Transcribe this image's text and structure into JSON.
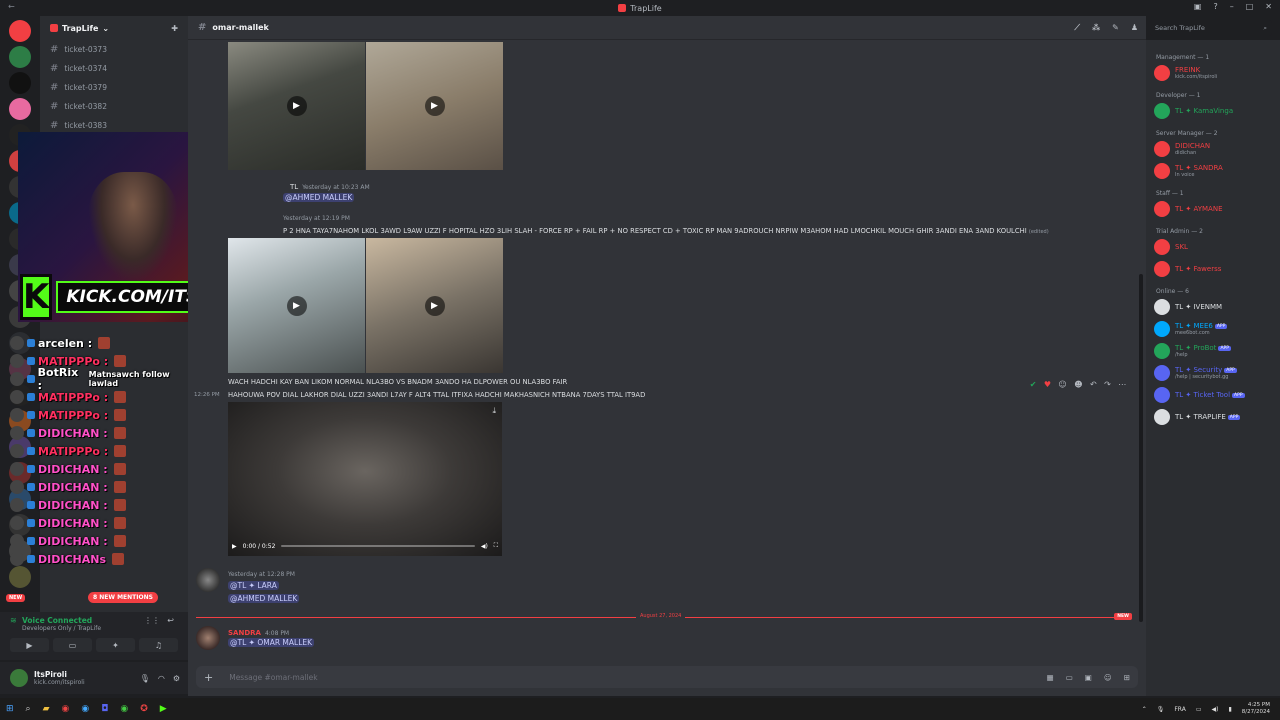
{
  "window": {
    "title": "TrapLife"
  },
  "server": {
    "name": "TrapLife"
  },
  "channels": [
    "ticket-0373",
    "ticket-0374",
    "ticket-0379",
    "ticket-0382",
    "ticket-0383"
  ],
  "active_channel": "omar-mallek",
  "stream_overlay": {
    "kick_url": "KICK.COM/ITSPIROLI",
    "chat": [
      {
        "name": "arcelen :",
        "color": "#ffffff",
        "text": ""
      },
      {
        "name": "MATIPPPo :",
        "color": "#ff3060",
        "text": ""
      },
      {
        "name": "BotRix :",
        "color": "#ffffff",
        "text": "Matnsawch follow lawlad"
      },
      {
        "name": "MATIPPPo :",
        "color": "#ff3060",
        "text": ""
      },
      {
        "name": "MATIPPPo :",
        "color": "#ff3060",
        "text": ""
      },
      {
        "name": "DIDICHAN :",
        "color": "#ff50c8",
        "text": ""
      },
      {
        "name": "MATIPPPo :",
        "color": "#ff3060",
        "text": ""
      },
      {
        "name": "DIDICHAN :",
        "color": "#ff50c8",
        "text": ""
      },
      {
        "name": "DIDICHAN :",
        "color": "#ff50c8",
        "text": ""
      },
      {
        "name": "DIDICHAN :",
        "color": "#ff50c8",
        "text": ""
      },
      {
        "name": "DIDICHAN :",
        "color": "#ff50c8",
        "text": ""
      },
      {
        "name": "DIDICHAN :",
        "color": "#ff50c8",
        "text": ""
      },
      {
        "name": "DIDICHANs",
        "color": "#ff50c8",
        "text": ""
      }
    ]
  },
  "new_mentions": "8 NEW MENTIONS",
  "new_label": "NEW",
  "voice": {
    "status": "Voice Connected",
    "location": "Developers Only / TrapLife"
  },
  "user": {
    "name": "ItsPiroli",
    "status": "kick.com/itspiroli"
  },
  "search": {
    "placeholder": "Search TrapLife"
  },
  "messages": {
    "m1_time": "Yesterday at 10:23 AM",
    "m1_mention": "@AHMED MALLEK",
    "m2_time": "Yesterday at 12:19 PM",
    "m2_text": "P 2 HNA TAYA7NAHOM LKOL 3AWD L9AW UZZI F HOPITAL HZO 3LIH SLAH  - FORCE RP + FAIL RP + NO RESPECT CD + TOXIC RP  MAN 9ADROUCH NRPIW M3AHOM HAD LMOCHKIL MOUCH GHIR 3ANDI ENA 3AND KOULCHI",
    "m2_edited": "(edited)",
    "m3_line1": "WACH HADCHI KAY BAN LIKOM NORMAL NLA3BO VS BNADM 3ANDO HA DLPOWER OU NLA3BO FAIR",
    "m3_line2": "HAHOUWA POV DIAL LAKHOR DIAL UZZI 3ANDI L7AY F ALT4 TTAL ITFIXA HADCHI MAKHASNICH NTBANA 7DAYS TTAL IT9AD",
    "m3_ts": "12:26 PM",
    "video_time": "0:00 / 0:52",
    "m4_time": "Yesterday at 12:28 PM",
    "m4_tag": "@TL",
    "m4_name": "LARA",
    "m4_mention": "@AHMED MALLEK",
    "divider_date": "August 27, 2024",
    "divider_new": "NEW",
    "m5_name": "SANDRA",
    "m5_time": "4:08 PM",
    "m5_tag": "@TL",
    "m5_mention": "OMAR MALLEK"
  },
  "composer": {
    "placeholder": "Message #omar-mallek"
  },
  "members": [
    {
      "group": "Management — 1",
      "items": [
        {
          "name": "FREINK",
          "sub": "kick.com/itspiroli",
          "color": "#f23f43"
        }
      ]
    },
    {
      "group": "Developer — 1",
      "items": [
        {
          "name": "TL ✦ KamaVinga",
          "sub": "",
          "color": "#23a55a"
        }
      ]
    },
    {
      "group": "Server Manager — 2",
      "items": [
        {
          "name": "DIDICHAN",
          "sub": "didichan",
          "color": "#f23f43"
        },
        {
          "name": "TL ✦ SANDRA",
          "sub": "In voice",
          "color": "#f23f43"
        }
      ]
    },
    {
      "group": "Staff — 1",
      "items": [
        {
          "name": "TL ✦ AYMANE",
          "sub": "",
          "color": "#f23f43"
        }
      ]
    },
    {
      "group": "Trial Admin — 2",
      "items": [
        {
          "name": "SKL",
          "sub": "",
          "color": "#f23f43"
        },
        {
          "name": "TL ✦ Fawerss",
          "sub": "",
          "color": "#f23f43"
        }
      ]
    },
    {
      "group": "Online — 6",
      "items": [
        {
          "name": "TL ✦ IVENMM",
          "sub": "",
          "color": "#dbdee1",
          "app": ""
        },
        {
          "name": "TL ✦ MEE6",
          "sub": "mee6bot.com",
          "color": "#00a8fc",
          "app": "APP"
        },
        {
          "name": "TL ✦ ProBot",
          "sub": "/help",
          "color": "#23a55a",
          "app": "APP"
        },
        {
          "name": "TL ✦ Security",
          "sub": "/help | securitybot.gg",
          "color": "#5865f2",
          "app": "APP"
        },
        {
          "name": "TL ✦ Ticket Tool",
          "sub": "",
          "color": "#5865f2",
          "app": "APP"
        },
        {
          "name": "TL ✦ TRAPLIFE",
          "sub": "",
          "color": "#dbdee1",
          "app": "APP"
        }
      ]
    }
  ],
  "taskbar": {
    "lang": "FRA",
    "time": "4:25 PM",
    "date": "8/27/2024"
  },
  "colors": {
    "bg": "#313338",
    "sidebar": "#2b2d31",
    "accent": "#5865f2",
    "red": "#f23f43",
    "green": "#23a55a",
    "kick": "#53fc18"
  }
}
